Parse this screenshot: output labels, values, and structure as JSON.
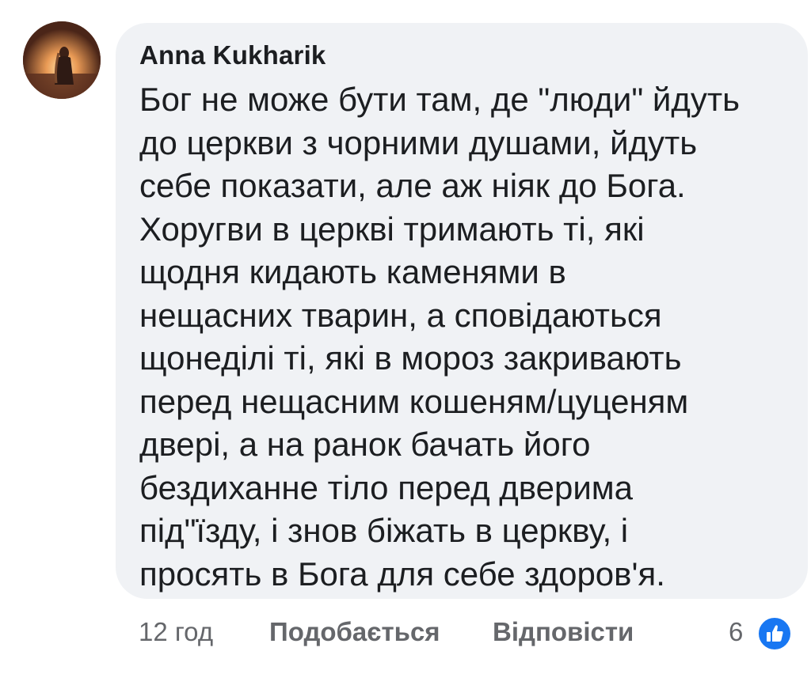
{
  "comment": {
    "author": "Anna Kukharik",
    "text": "Бог не може бути там, де \"люди\" йдуть\nдо церкви з чорними душами, йдуть\nсебе показати, але аж ніяк до Бога.\nХоругви в церкві тримають  ті, які\nщодня кидають каменями в\nнещасних тварин, а сповідаються\nщонеділі ті, які в мороз закривають\nперед нещасним кошеням/цуценям\nдвері, а на ранок бачать його\nбездиханне тіло перед дверима\nпід\"їзду, і знов біжать  в церкву, і\nпросять в Бога для себе здоров'я.",
    "avatar_icon": "profile-photo-woman-sunset"
  },
  "actions": {
    "time": "12 год",
    "like_label": "Подобається",
    "reply_label": "Відповісти",
    "reaction_count": "6",
    "reaction_icon": "thumbs-up-icon"
  },
  "colors": {
    "bubble": "#f0f2f5",
    "text": "#1c1e21",
    "muted": "#65676b",
    "like_blue": "#1877f2"
  }
}
